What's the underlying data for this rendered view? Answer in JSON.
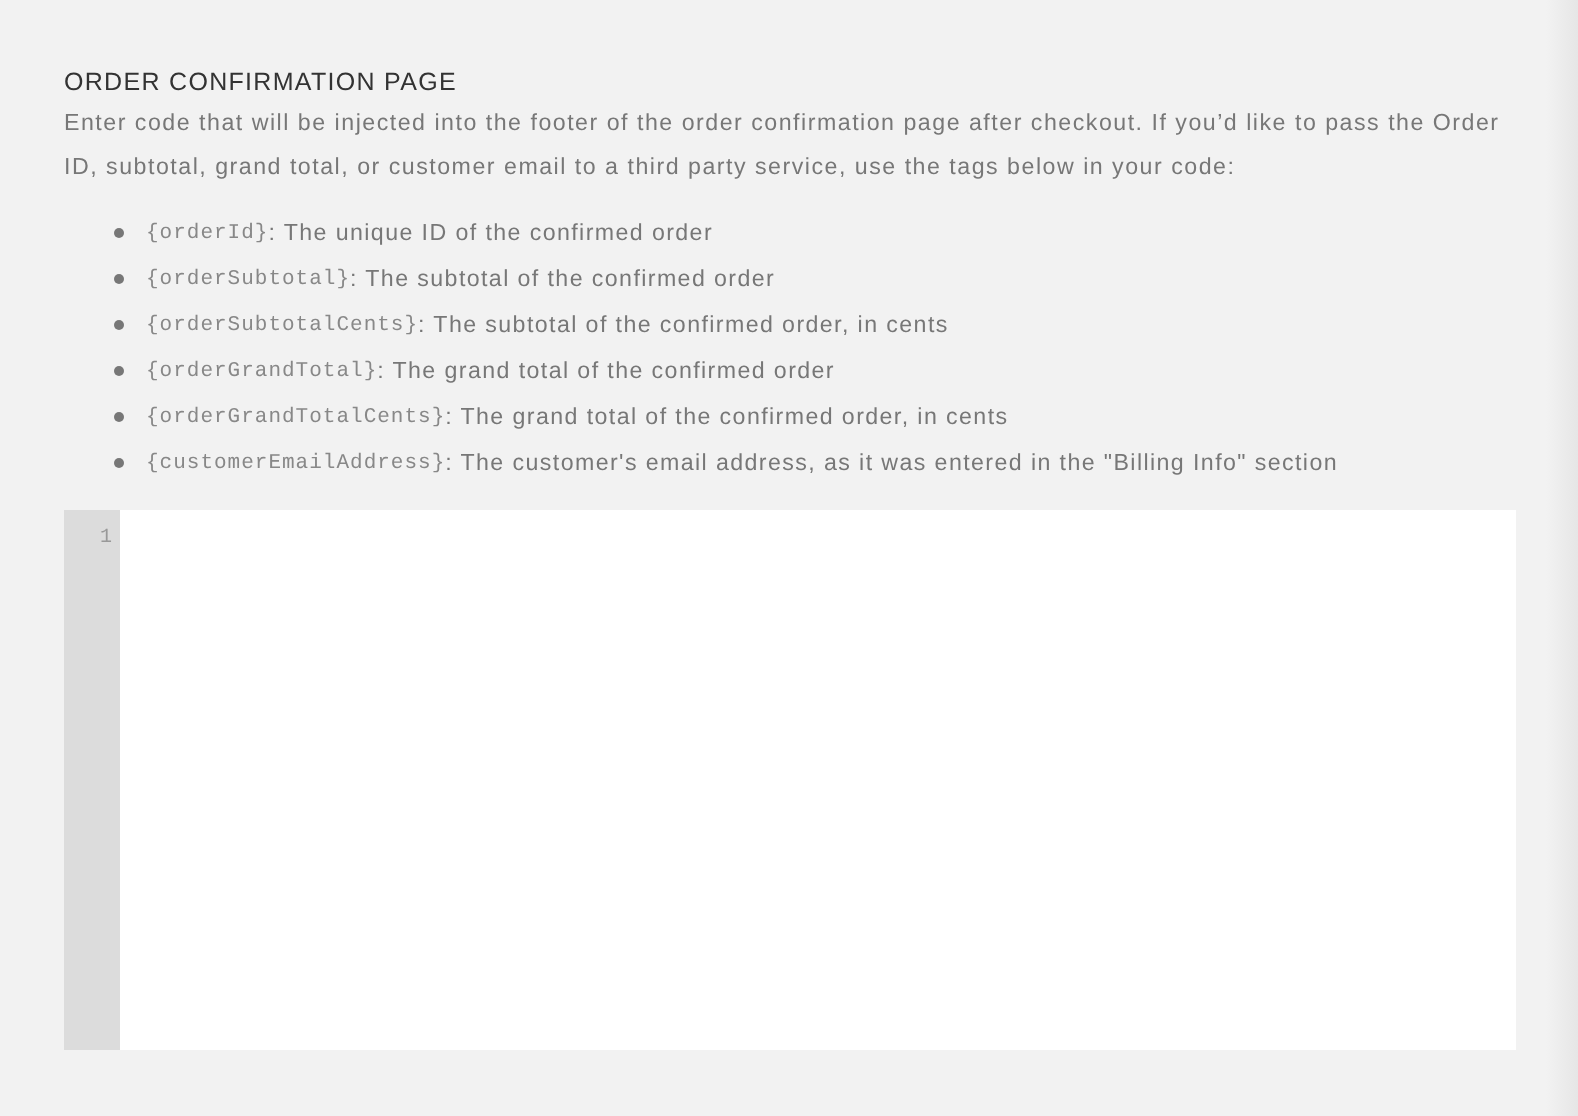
{
  "section": {
    "title": "ORDER CONFIRMATION PAGE",
    "description": "Enter code that will be injected into the footer of the order confirmation page after checkout. If you’d like to pass the Order ID, subtotal, grand total, or customer email to a third party service, use the tags below in your code:"
  },
  "tags": [
    {
      "tag": "{orderId}",
      "description": ": The unique ID of the confirmed order"
    },
    {
      "tag": "{orderSubtotal}",
      "description": ": The subtotal of the confirmed order"
    },
    {
      "tag": "{orderSubtotalCents}",
      "description": ": The subtotal of the confirmed order, in cents"
    },
    {
      "tag": "{orderGrandTotal}",
      "description": ": The grand total of the confirmed order"
    },
    {
      "tag": "{orderGrandTotalCents}",
      "description": ": The grand total of the confirmed order, in cents"
    },
    {
      "tag": "{customerEmailAddress}",
      "description": ": The customer's email address, as it was entered in the \"Billing Info\" section"
    }
  ],
  "editor": {
    "line_numbers": [
      "1"
    ]
  }
}
